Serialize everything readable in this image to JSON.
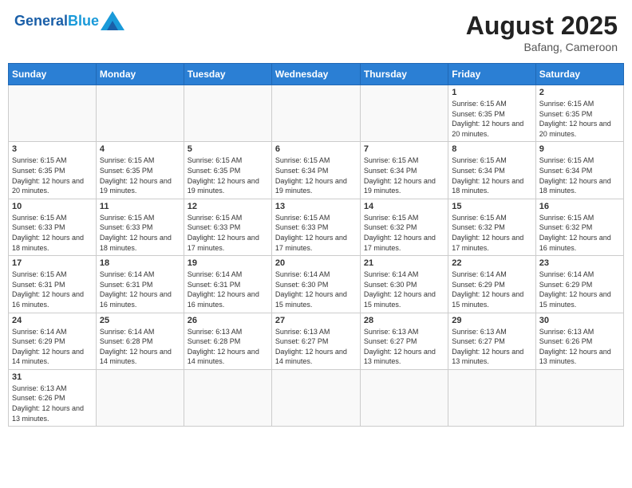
{
  "header": {
    "logo_general": "General",
    "logo_blue": "Blue",
    "month_year": "August 2025",
    "location": "Bafang, Cameroon"
  },
  "days_of_week": [
    "Sunday",
    "Monday",
    "Tuesday",
    "Wednesday",
    "Thursday",
    "Friday",
    "Saturday"
  ],
  "weeks": [
    [
      {
        "num": "",
        "info": ""
      },
      {
        "num": "",
        "info": ""
      },
      {
        "num": "",
        "info": ""
      },
      {
        "num": "",
        "info": ""
      },
      {
        "num": "",
        "info": ""
      },
      {
        "num": "1",
        "info": "Sunrise: 6:15 AM\nSunset: 6:35 PM\nDaylight: 12 hours and 20 minutes."
      },
      {
        "num": "2",
        "info": "Sunrise: 6:15 AM\nSunset: 6:35 PM\nDaylight: 12 hours and 20 minutes."
      }
    ],
    [
      {
        "num": "3",
        "info": "Sunrise: 6:15 AM\nSunset: 6:35 PM\nDaylight: 12 hours and 20 minutes."
      },
      {
        "num": "4",
        "info": "Sunrise: 6:15 AM\nSunset: 6:35 PM\nDaylight: 12 hours and 19 minutes."
      },
      {
        "num": "5",
        "info": "Sunrise: 6:15 AM\nSunset: 6:35 PM\nDaylight: 12 hours and 19 minutes."
      },
      {
        "num": "6",
        "info": "Sunrise: 6:15 AM\nSunset: 6:34 PM\nDaylight: 12 hours and 19 minutes."
      },
      {
        "num": "7",
        "info": "Sunrise: 6:15 AM\nSunset: 6:34 PM\nDaylight: 12 hours and 19 minutes."
      },
      {
        "num": "8",
        "info": "Sunrise: 6:15 AM\nSunset: 6:34 PM\nDaylight: 12 hours and 18 minutes."
      },
      {
        "num": "9",
        "info": "Sunrise: 6:15 AM\nSunset: 6:34 PM\nDaylight: 12 hours and 18 minutes."
      }
    ],
    [
      {
        "num": "10",
        "info": "Sunrise: 6:15 AM\nSunset: 6:33 PM\nDaylight: 12 hours and 18 minutes."
      },
      {
        "num": "11",
        "info": "Sunrise: 6:15 AM\nSunset: 6:33 PM\nDaylight: 12 hours and 18 minutes."
      },
      {
        "num": "12",
        "info": "Sunrise: 6:15 AM\nSunset: 6:33 PM\nDaylight: 12 hours and 17 minutes."
      },
      {
        "num": "13",
        "info": "Sunrise: 6:15 AM\nSunset: 6:33 PM\nDaylight: 12 hours and 17 minutes."
      },
      {
        "num": "14",
        "info": "Sunrise: 6:15 AM\nSunset: 6:32 PM\nDaylight: 12 hours and 17 minutes."
      },
      {
        "num": "15",
        "info": "Sunrise: 6:15 AM\nSunset: 6:32 PM\nDaylight: 12 hours and 17 minutes."
      },
      {
        "num": "16",
        "info": "Sunrise: 6:15 AM\nSunset: 6:32 PM\nDaylight: 12 hours and 16 minutes."
      }
    ],
    [
      {
        "num": "17",
        "info": "Sunrise: 6:15 AM\nSunset: 6:31 PM\nDaylight: 12 hours and 16 minutes."
      },
      {
        "num": "18",
        "info": "Sunrise: 6:14 AM\nSunset: 6:31 PM\nDaylight: 12 hours and 16 minutes."
      },
      {
        "num": "19",
        "info": "Sunrise: 6:14 AM\nSunset: 6:31 PM\nDaylight: 12 hours and 16 minutes."
      },
      {
        "num": "20",
        "info": "Sunrise: 6:14 AM\nSunset: 6:30 PM\nDaylight: 12 hours and 15 minutes."
      },
      {
        "num": "21",
        "info": "Sunrise: 6:14 AM\nSunset: 6:30 PM\nDaylight: 12 hours and 15 minutes."
      },
      {
        "num": "22",
        "info": "Sunrise: 6:14 AM\nSunset: 6:29 PM\nDaylight: 12 hours and 15 minutes."
      },
      {
        "num": "23",
        "info": "Sunrise: 6:14 AM\nSunset: 6:29 PM\nDaylight: 12 hours and 15 minutes."
      }
    ],
    [
      {
        "num": "24",
        "info": "Sunrise: 6:14 AM\nSunset: 6:29 PM\nDaylight: 12 hours and 14 minutes."
      },
      {
        "num": "25",
        "info": "Sunrise: 6:14 AM\nSunset: 6:28 PM\nDaylight: 12 hours and 14 minutes."
      },
      {
        "num": "26",
        "info": "Sunrise: 6:13 AM\nSunset: 6:28 PM\nDaylight: 12 hours and 14 minutes."
      },
      {
        "num": "27",
        "info": "Sunrise: 6:13 AM\nSunset: 6:27 PM\nDaylight: 12 hours and 14 minutes."
      },
      {
        "num": "28",
        "info": "Sunrise: 6:13 AM\nSunset: 6:27 PM\nDaylight: 12 hours and 13 minutes."
      },
      {
        "num": "29",
        "info": "Sunrise: 6:13 AM\nSunset: 6:27 PM\nDaylight: 12 hours and 13 minutes."
      },
      {
        "num": "30",
        "info": "Sunrise: 6:13 AM\nSunset: 6:26 PM\nDaylight: 12 hours and 13 minutes."
      }
    ],
    [
      {
        "num": "31",
        "info": "Sunrise: 6:13 AM\nSunset: 6:26 PM\nDaylight: 12 hours and 13 minutes."
      },
      {
        "num": "",
        "info": ""
      },
      {
        "num": "",
        "info": ""
      },
      {
        "num": "",
        "info": ""
      },
      {
        "num": "",
        "info": ""
      },
      {
        "num": "",
        "info": ""
      },
      {
        "num": "",
        "info": ""
      }
    ]
  ]
}
